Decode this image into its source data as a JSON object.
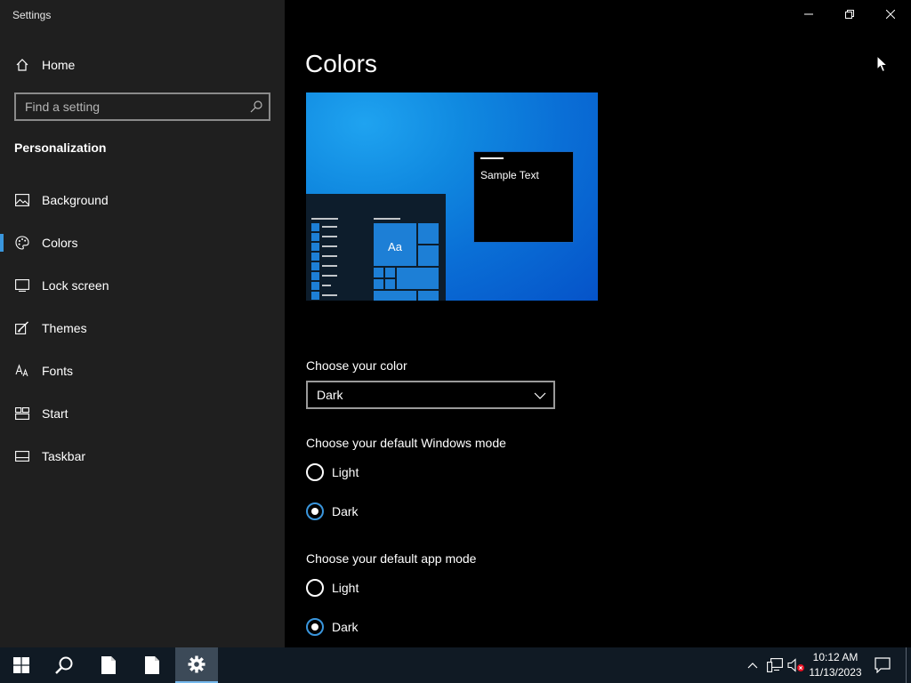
{
  "window": {
    "title": "Settings"
  },
  "sidebar": {
    "home_label": "Home",
    "search_placeholder": "Find a setting",
    "section_heading": "Personalization",
    "items": [
      {
        "label": "Background",
        "icon": "picture-icon"
      },
      {
        "label": "Colors",
        "icon": "palette-icon",
        "selected": true
      },
      {
        "label": "Lock screen",
        "icon": "lock-screen-icon"
      },
      {
        "label": "Themes",
        "icon": "brush-icon"
      },
      {
        "label": "Fonts",
        "icon": "fonts-icon"
      },
      {
        "label": "Start",
        "icon": "start-icon"
      },
      {
        "label": "Taskbar",
        "icon": "taskbar-icon"
      }
    ]
  },
  "main": {
    "page_title": "Colors",
    "preview": {
      "sample_text": "Sample Text",
      "tile_text": "Aa"
    },
    "choose_color": {
      "label": "Choose your color",
      "value": "Dark"
    },
    "windows_mode": {
      "label": "Choose your default Windows mode",
      "options": [
        {
          "label": "Light",
          "checked": false
        },
        {
          "label": "Dark",
          "checked": true
        }
      ]
    },
    "app_mode": {
      "label": "Choose your default app mode",
      "options": [
        {
          "label": "Light",
          "checked": false
        },
        {
          "label": "Dark",
          "checked": true
        }
      ]
    }
  },
  "taskbar": {
    "apps": [
      "start-icon",
      "search-icon",
      "document-icon",
      "document-icon",
      "settings-icon"
    ],
    "clock": {
      "time": "10:12 AM",
      "date": "11/13/2023"
    }
  },
  "colors": {
    "accent": "#3a96dd",
    "sidebar_bg": "#1f1f1f",
    "taskbar_bg": "#101a24"
  }
}
